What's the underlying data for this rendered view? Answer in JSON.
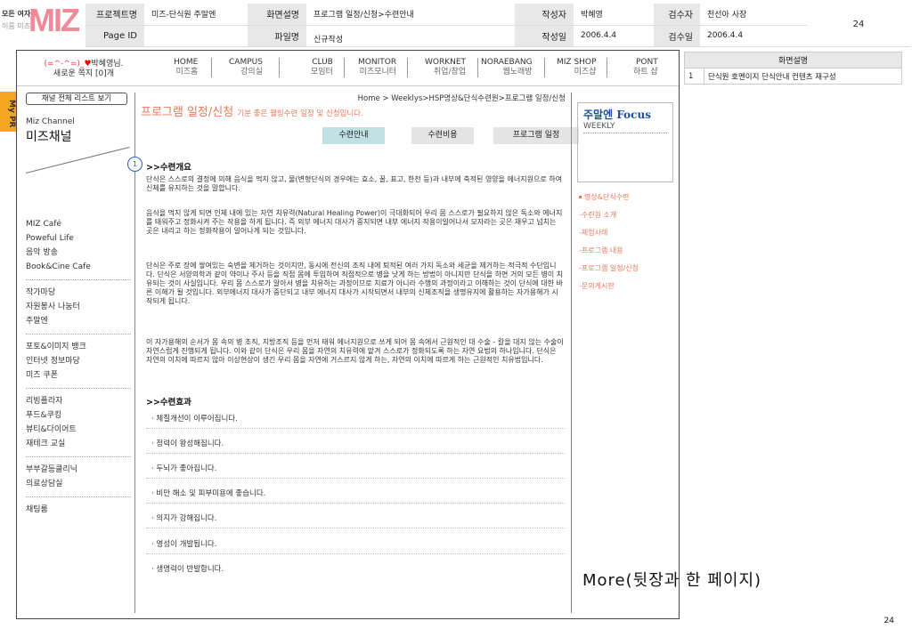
{
  "doc_header": {
    "logo_tag1": "모든 여자의",
    "logo_tag2": "이름 미즈",
    "logo_mark": "MIZ",
    "project_label": "프로젝트명",
    "project_value": "미즈-단식원 주말엔",
    "screen_label": "화면설명",
    "screen_value": "프로그램 일정/신청>수련안내",
    "author_label": "작성자",
    "author_value": "박혜영",
    "reviewer_label": "검수자",
    "reviewer_value": "천선아 사장",
    "page_num": "24",
    "pageid_label": "Page ID",
    "pageid_value": "",
    "file_label": "파일명",
    "file_value": "신규작성",
    "date_label": "작성일",
    "date_value": "2006.4.4",
    "review_date_label": "검수일",
    "review_date_value": "2006.4.4"
  },
  "topnav": {
    "user_line1": "(=^-^=)_",
    "user_heart": "♥",
    "user_name": "박혜영님.",
    "user_line2": "새로운 쪽지 [0]개",
    "items": [
      {
        "en": "HOME",
        "ko": "미즈홈"
      },
      {
        "en": "CAMPUS",
        "ko": "강의실"
      },
      {
        "en": "CLUB",
        "ko": "모임터"
      },
      {
        "en": "MONITOR",
        "ko": "미즈모니터"
      },
      {
        "en": "WORKNET",
        "ko": "취업/창업"
      },
      {
        "en": "NORAEBANG",
        "ko": "웹노래방"
      },
      {
        "en": "MIZ SHOP",
        "ko": "미즈샵"
      },
      {
        "en": "PONT",
        "ko": "하트 샵"
      }
    ]
  },
  "mypr": "My PR",
  "sidebar": {
    "all_list": "채널 전체 리스트 보기",
    "channel_en": "Miz Channel",
    "channel_ko": "미즈채널",
    "groups": [
      [
        "MIZ Café",
        "Poweful Life",
        "음악 방송",
        "Book&Cine Cafe"
      ],
      [
        "작가마당",
        "자원봉사 나눔터",
        "주말엔"
      ],
      [
        "포토&이미지 뱅크",
        "인터넷 정보마당",
        "미즈 쿠폰"
      ],
      [
        "리빙플라자",
        "푸드&쿠킹",
        "뷰티&다이어트",
        "재테크 교실"
      ],
      [
        "부부갈등클리닉",
        "의료상담실"
      ],
      [
        "채팅룸"
      ]
    ]
  },
  "main": {
    "breadcrumb": "Home > Weeklys>HSP명상&단식수련원>프로그램 일정/신청",
    "title": "프로그램 일정/신청",
    "title_sub": "기분 좋은 웰빙수련 일정 및 신청입니다.",
    "tabs": [
      "수련안내",
      "수련비용",
      "프로그램 일정"
    ],
    "badge": "1",
    "section1": ">>수련개요",
    "paragraphs": [
      "단식은 스스로의 결정에 의해 음식을 먹지 않고, 물(변형단식의 경우에는 효소, 꿀, 표고, 한천 등)과 내부에 축적된 영양을 에너지원으로 하여 신체를 유지하는 것을 말합니다.",
      "음식을 먹지 않게 되면 인체 내에 있는 자연 치유력(Natural Healing Power)이 극대화되어 우리 몸 스스로가 필요하지 않은 독소와 에너지를 태워주고 정화시켜 주는 작용을 하게 됩니다. 즉 외부 에너지 대사가 중지되면 내부 에너지 작용이일어나서 모자라는 곳은 채우고 넘치는 곳은 내리고 하는 정화작용이 일어나게 되는 것입니다.",
      "단식은 주로 장에 쌓여있는 숙변을 제거하는 것이지만, 동시에 전신의 조직 내에 퇴적된 여러 가지 독소와 세균을 제거하는 적극적 수단입니다. 단식은 서양의학과 같이 약이나 주사 등을 직접 몸에 투입하여 직접적으로 병을 낫게 하는 방법이 아니지만 단식을 하면 거의 모든 병이 치유되는 것이 사실입니다. 우리 몸 스스로가 알아서 병을 치유하는 과정이므로 치료가 아니라 수행의 과정이라고 이해하는 것이 단식에 대한 바른 이해가 될 것입니다. 외부에너지 대사가 중단되고 내부 에너지 대사가 시작되면서 내부의 신체조직을 생명유지에 활용하는 자가용해가 시작되게 됩니다.",
      "이 자가용해의 순서가 몸 속의 병 조직, 지방조직 등을 먼저 태워 에너지원으로 쓰게 되어 몸 속에서 근원적인 대 수술 - 칼을 대지 않는 수술이 자연스럽게 진행되게 됩니다. 이와 같이 단식은 우리 몸을 자연의 치유력에 맡겨 스스로가 정화되도록 하는 자연 요법의 하나입니다. 단식은 자연의 이치에 따르지 않아 이상현상이 생긴 우리 몸을 자연에 거스르지 않게 하는, 자연의 이치에 따르게 하는 근원적인 치유법입니다."
    ],
    "section2": ">>수련효과",
    "effects": [
      "· 체질개선이 이루어집니다.",
      "· 정력이 왕성해집니다.",
      "· 두뇌가 좋아집니다.",
      "· 비만 해소 및 피부미용에 좋습니다.",
      "· 의지가 강해집니다.",
      "· 영성이 개발됩니다.",
      "· 생명력이 반발합니다."
    ]
  },
  "focus": {
    "title_ko": "주말엔",
    "title_en": "Focus",
    "sub": "WEEKLY",
    "items": [
      "명상&단식수련",
      "-수련원 소개",
      "-체험사례",
      "-프로그램 내용",
      "-프로그램 일정/신청",
      "-문의게시판"
    ]
  },
  "more_note": "More(뒷장과 한 페이지)",
  "page_footer": "24",
  "description": {
    "header": "화면설명",
    "rows": [
      {
        "no": "1",
        "text": "단식원 호멘이지 단식안내 컨텐츠 재구성"
      }
    ]
  }
}
